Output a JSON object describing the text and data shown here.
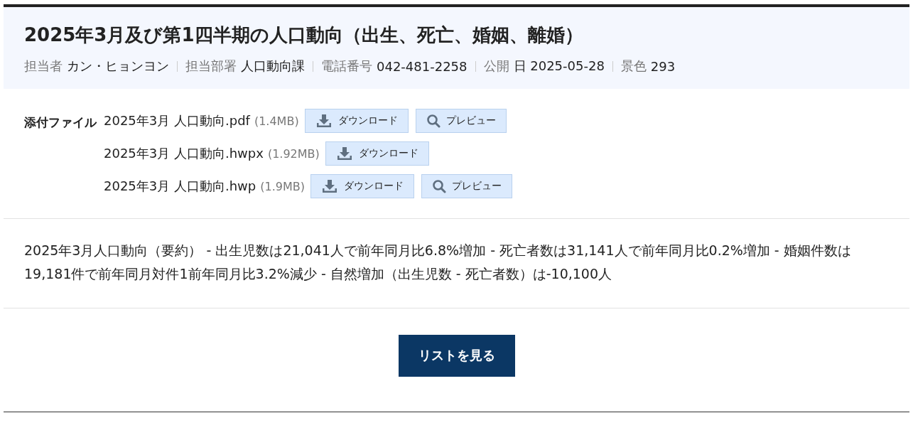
{
  "title": "2025年3月及び第1四半期の人口動向（出生、死亡、婚姻、離婚）",
  "meta": [
    {
      "label": "担当者",
      "value": "カン・ヒョンヨン"
    },
    {
      "label": "担当部署",
      "value": "人口動向課"
    },
    {
      "label": "電話番号",
      "value": "042-481-2258"
    },
    {
      "label": "公開",
      "value": "日 2025-05-28"
    },
    {
      "label": "景色",
      "value": "293"
    }
  ],
  "attachments": {
    "label": "添付ファイル",
    "files": [
      {
        "name": "2025年3月 人口動向.pdf",
        "size": "(1.4MB)",
        "buttons": [
          {
            "kind": "download",
            "label": "ダウンロード"
          },
          {
            "kind": "preview",
            "label": "プレビュー"
          }
        ]
      },
      {
        "name": "2025年3月 人口動向.hwpx",
        "size": "(1.92MB)",
        "buttons": [
          {
            "kind": "download",
            "label": "ダウンロード"
          }
        ]
      },
      {
        "name": "2025年3月 人口動向.hwp",
        "size": "(1.9MB)",
        "buttons": [
          {
            "kind": "download",
            "label": "ダウンロード"
          },
          {
            "kind": "preview",
            "label": "プレビュー"
          }
        ]
      }
    ]
  },
  "summary": "2025年3月人口動向（要約） - 出生児数は21,041人で前年同月比6.8%増加 - 死亡者数は31,141人で前年同月比0.2%増加 - 婚姻件数は19,181件で前年同月対件1前年同月比3.2%減少 - 自然増加（出生児数 - 死亡者数）は-10,100人",
  "list_button": "リストを見る"
}
